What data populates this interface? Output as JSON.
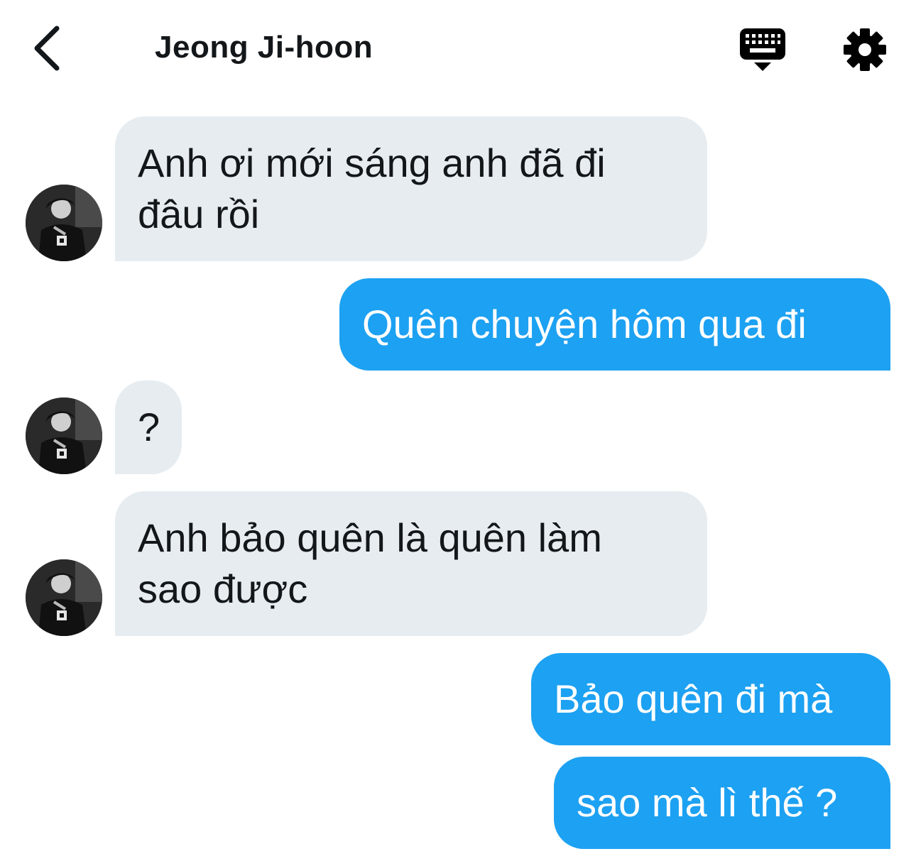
{
  "header": {
    "title": "Jeong Ji-hoon",
    "back_icon": "chevron-left-icon",
    "keyboard_icon": "keyboard-icon",
    "settings_icon": "gear-icon"
  },
  "messages": [
    {
      "direction": "in",
      "lines": [
        "Anh ơi mới sáng anh đã đi",
        "đâu rồi"
      ]
    },
    {
      "direction": "out",
      "lines": [
        "Quên chuyện hôm qua đi"
      ]
    },
    {
      "direction": "in",
      "lines": [
        "?"
      ]
    },
    {
      "direction": "in",
      "lines": [
        "Anh bảo quên là quên làm",
        "sao được"
      ]
    },
    {
      "direction": "out",
      "lines": [
        "Bảo quên đi mà"
      ]
    },
    {
      "direction": "out",
      "lines": [
        "sao mà lì thế ?"
      ]
    }
  ],
  "colors": {
    "incoming_bubble": "#e6ecf0",
    "outgoing_bubble": "#1da1f2",
    "text_dark": "#14171a",
    "text_light": "#ffffff"
  }
}
